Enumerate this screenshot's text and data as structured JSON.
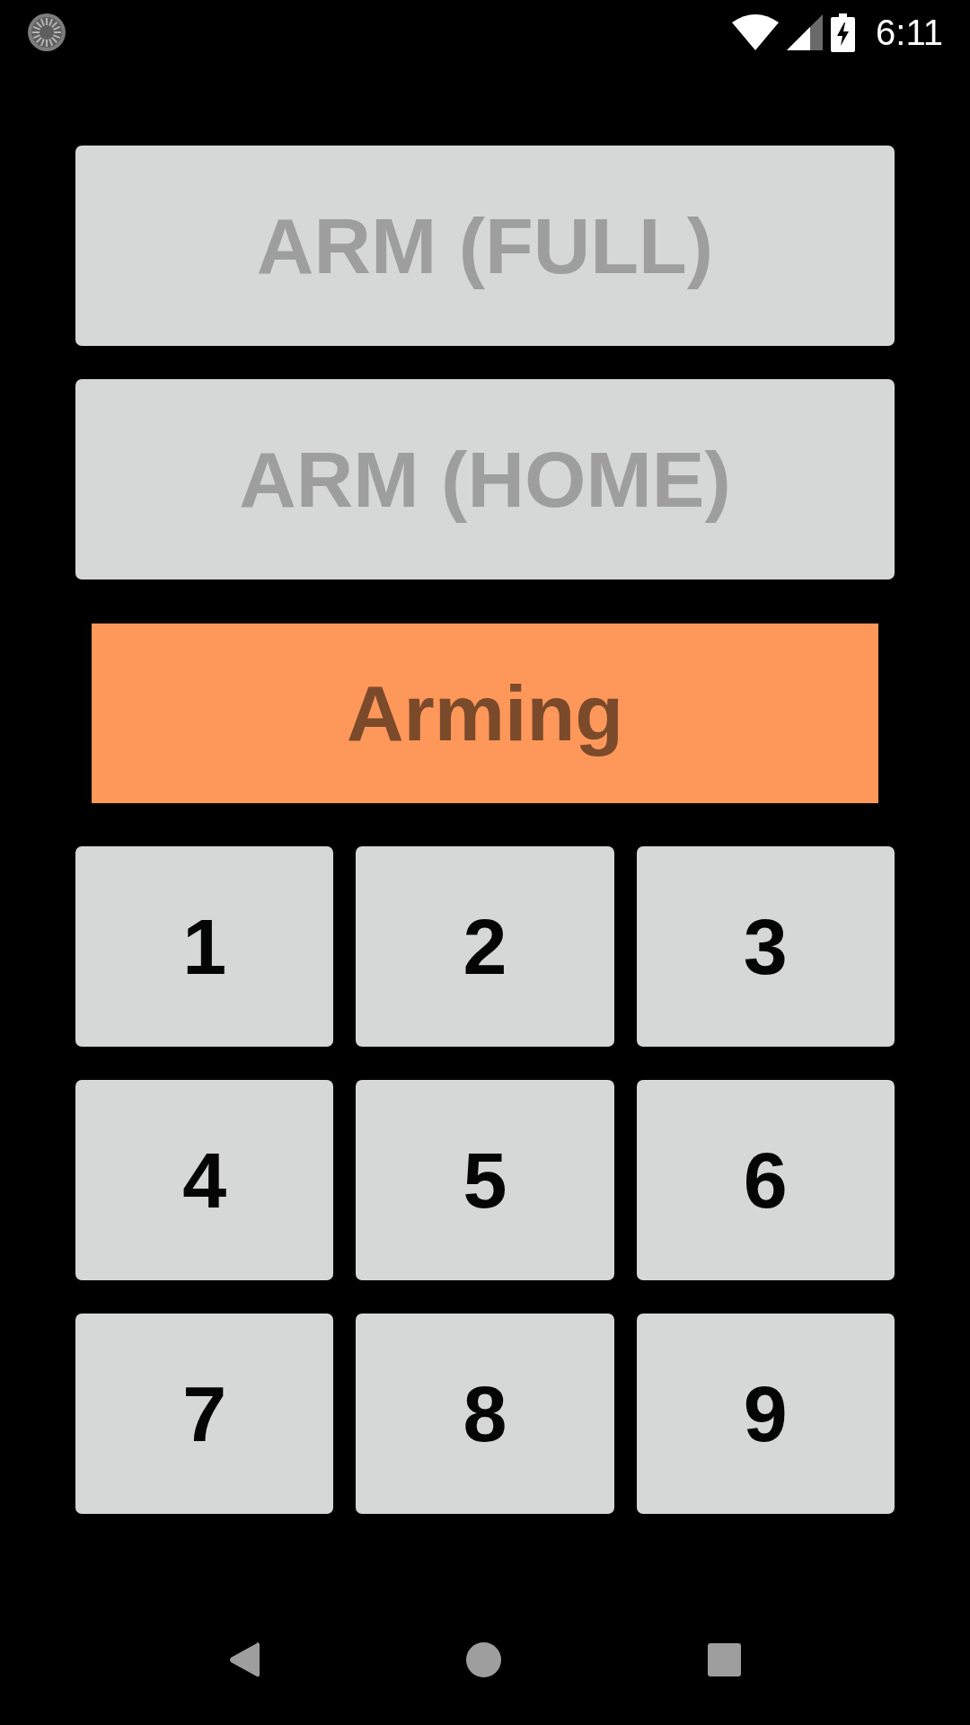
{
  "status_bar": {
    "time": "6:11"
  },
  "arm_buttons": [
    {
      "label": "ARM (FULL)",
      "disabled": true
    },
    {
      "label": "ARM (HOME)",
      "disabled": true
    }
  ],
  "status_banner": {
    "label": "Arming"
  },
  "keypad": [
    {
      "label": "1",
      "disabled": false
    },
    {
      "label": "2",
      "disabled": false
    },
    {
      "label": "3",
      "disabled": false
    },
    {
      "label": "4",
      "disabled": false
    },
    {
      "label": "5",
      "disabled": false
    },
    {
      "label": "6",
      "disabled": false
    },
    {
      "label": "7",
      "disabled": false
    },
    {
      "label": "8",
      "disabled": false
    },
    {
      "label": "9",
      "disabled": false
    }
  ]
}
